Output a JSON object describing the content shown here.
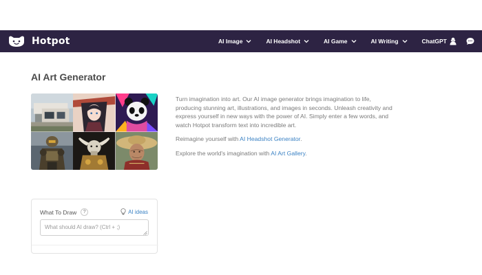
{
  "app": {
    "brand": "Hotpot",
    "colors": {
      "navbar": "#2d2343",
      "link": "#3b82c4",
      "text": "#7a7a7a",
      "heading": "#4b4b4b"
    }
  },
  "nav": {
    "items": [
      {
        "label": "AI Image"
      },
      {
        "label": "AI Headshot"
      },
      {
        "label": "AI Game"
      },
      {
        "label": "AI Writing"
      },
      {
        "label": "ChatGPT"
      }
    ],
    "icons": [
      "user-icon",
      "chat-bubble-icon"
    ]
  },
  "main": {
    "title": "AI Art Generator",
    "gallery": [
      "modern-house",
      "anime-girl-with-hat",
      "colorful-panda",
      "robot-soldier",
      "mechanical-bull",
      "elderly-woman-with-straw-hat"
    ],
    "intro": "Turn imagination into art. Our AI image generator brings imagination to life, producing stunning art, illustrations, and images in seconds. Unleash creativity and express yourself in new ways with the power of AI. Simply enter a few words, and watch Hotpot transform text into incredible art.",
    "reimagine_prefix": "Reimagine yourself with ",
    "reimagine_link": "AI Headshot Generator",
    "reimagine_suffix": ".",
    "explore_prefix": "Explore the world's imagination with ",
    "explore_link": "AI Art Gallery",
    "explore_suffix": "."
  },
  "draw": {
    "label": "What To Draw",
    "help": "?",
    "ideas_label": "AI ideas",
    "placeholder": "What should AI draw? (Ctrl + ;)",
    "value": ""
  }
}
